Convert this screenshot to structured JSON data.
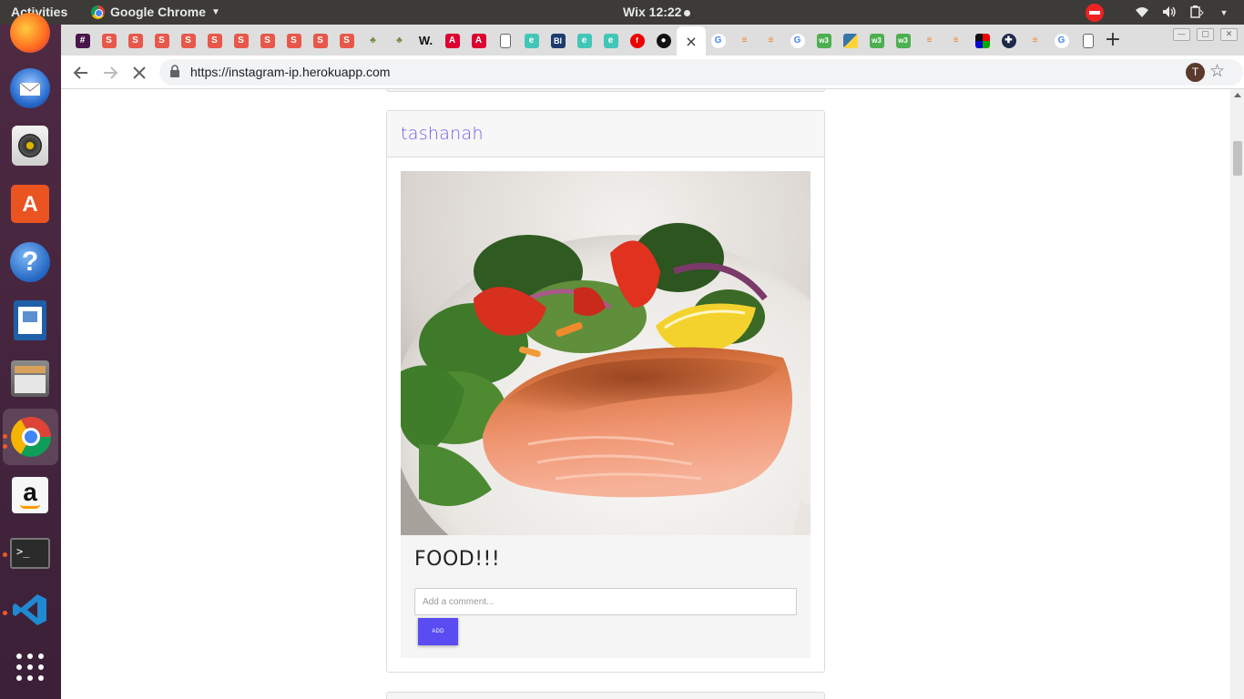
{
  "topbar": {
    "activities": "Activities",
    "app_name": "Google Chrome",
    "clock": "Wix 12:22"
  },
  "dock": {
    "items": [
      "firefox-icon",
      "thunderbird-icon",
      "rhythmbox-icon",
      "ubuntu-software-icon",
      "help-icon",
      "libreoffice-writer-icon",
      "files-icon",
      "chrome-icon",
      "amazon-icon",
      "terminal-icon",
      "vscode-icon",
      "show-apps-icon"
    ]
  },
  "browser": {
    "url": "https://instagram-ip.herokuapp.com",
    "profile_initial": "T",
    "active_tab_close": "×",
    "new_tab": "+",
    "tab_favicons": [
      "slack",
      "skillshare",
      "skillshare",
      "skillshare",
      "skillshare",
      "skillshare",
      "skillshare",
      "skillshare",
      "skillshare",
      "skillshare",
      "skillshare",
      "tree",
      "tree",
      "wikipedia",
      "angular",
      "angular",
      "page",
      "e",
      "bl",
      "e",
      "e",
      "red",
      "github"
    ],
    "tab_favicons_right": [
      "google",
      "stackoverflow",
      "stackoverflow",
      "google",
      "w3",
      "python",
      "w3",
      "w3",
      "stackoverflow",
      "stackoverflow",
      "colors",
      "pivotal",
      "stackoverflow",
      "google",
      "page"
    ],
    "colors": {
      "accent": "#5a4cf2",
      "username": "#6b5be8"
    }
  },
  "post": {
    "username": "tashanah",
    "caption": "FOOD!!!",
    "comment_placeholder": "Add a comment...",
    "comment_value": "",
    "add_button": "ADD"
  }
}
